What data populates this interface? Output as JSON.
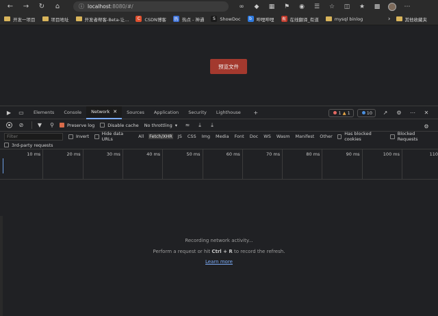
{
  "browser": {
    "url_host": "localhost",
    "url_path": ":8080/#/",
    "nav_icons": [
      "back-icon",
      "forward-icon",
      "refresh-icon",
      "home-icon"
    ]
  },
  "bookmarks": [
    {
      "label": "开发一项目",
      "type": "folder"
    },
    {
      "label": "项目地址",
      "type": "folder"
    },
    {
      "label": "开发者帮客-Beta-让...",
      "type": "folder"
    },
    {
      "label": "CSDN博客",
      "type": "site",
      "color": "#e0502f",
      "glyph": "C"
    },
    {
      "label": "热点 - 神通",
      "type": "site",
      "color": "#3b6fd6",
      "glyph": "热"
    },
    {
      "label": "ShowDoc",
      "type": "site",
      "color": "#1a1a1a",
      "glyph": "S"
    },
    {
      "label": "哔哩哔哩",
      "type": "site",
      "color": "#2f7be0",
      "glyph": "b"
    },
    {
      "label": "在线翻译_有道",
      "type": "site",
      "color": "#c0392b",
      "glyph": "有"
    },
    {
      "label": "mysql binlog",
      "type": "folder"
    },
    {
      "label": "其他收藏夹",
      "type": "folder"
    }
  ],
  "page": {
    "preview_button": "预览文件"
  },
  "devtools": {
    "tabs": [
      "Elements",
      "Console",
      "Network",
      "Sources",
      "Application",
      "Security",
      "Lighthouse"
    ],
    "active_tab": "Network",
    "errors_count": "1",
    "warnings_count": "1",
    "info_count": "10",
    "toolbar": {
      "preserve_log": "Preserve log",
      "disable_cache": "Disable cache",
      "throttling": "No throttling"
    },
    "filter": {
      "placeholder": "Filter",
      "invert": "Invert",
      "hide_data_urls": "Hide data URLs",
      "types": [
        "All",
        "Fetch/XHR",
        "JS",
        "CSS",
        "Img",
        "Media",
        "Font",
        "Doc",
        "WS",
        "Wasm",
        "Manifest",
        "Other"
      ],
      "active_type": "Fetch/XHR",
      "has_blocked_cookies": "Has blocked cookies",
      "blocked_requests": "Blocked Requests",
      "third_party": "3rd-party requests"
    },
    "timeline_ticks": [
      "10 ms",
      "20 ms",
      "30 ms",
      "40 ms",
      "50 ms",
      "60 ms",
      "70 ms",
      "80 ms",
      "90 ms",
      "100 ms",
      "110"
    ],
    "empty_state": {
      "line1": "Recording network activity...",
      "line2_pre": "Perform a request or hit ",
      "line2_key": "Ctrl + R",
      "line2_post": " to record the refresh.",
      "learn_more": "Learn more"
    }
  }
}
